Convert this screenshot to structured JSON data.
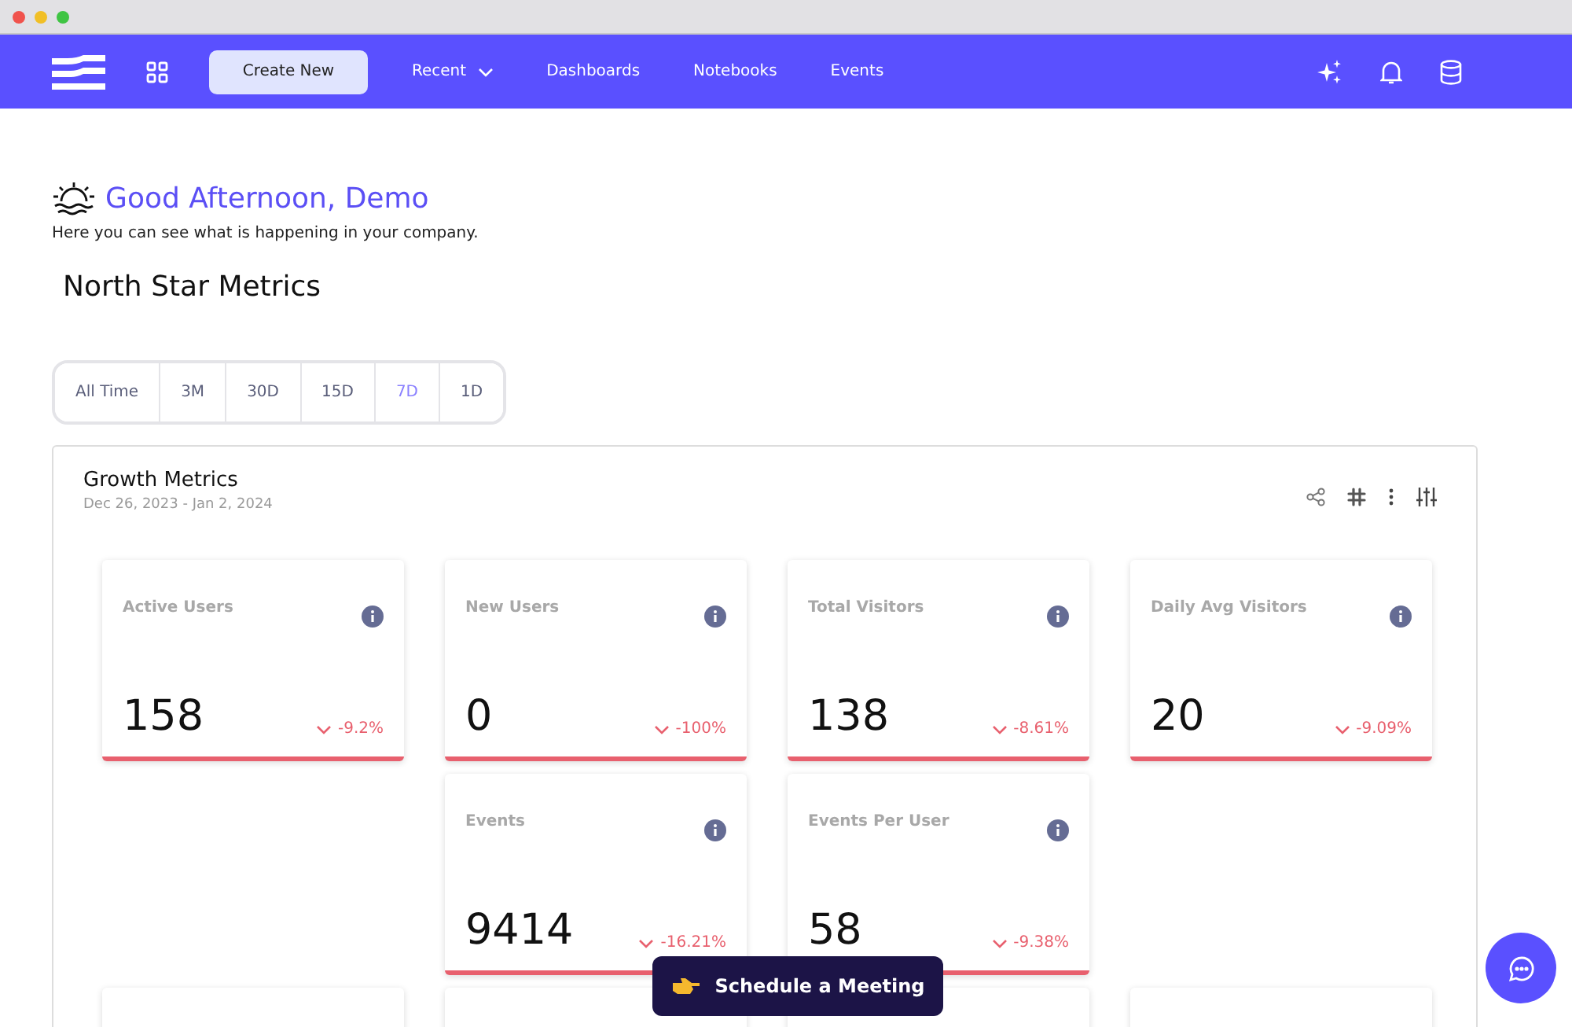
{
  "nav": {
    "create_button": "Create New",
    "items": [
      {
        "label": "Recent",
        "kind": "dropdown"
      },
      {
        "label": "Dashboards",
        "kind": "link"
      },
      {
        "label": "Notebooks",
        "kind": "link"
      },
      {
        "label": "Events",
        "kind": "link"
      }
    ]
  },
  "greeting": {
    "title": "Good Afternoon, Demo",
    "subtitle": "Here you can see what is happening in your company."
  },
  "section_title": "North Star Metrics",
  "ranges": [
    {
      "label": "All Time",
      "selected": false
    },
    {
      "label": "3M",
      "selected": false
    },
    {
      "label": "30D",
      "selected": false
    },
    {
      "label": "15D",
      "selected": false
    },
    {
      "label": "7D",
      "selected": true
    },
    {
      "label": "1D",
      "selected": false
    }
  ],
  "panel": {
    "title": "Growth Metrics",
    "date_range": "Dec 26, 2023 - Jan 2, 2024",
    "rows": [
      [
        {
          "kind": "metric",
          "label": "Active Users",
          "value": "158",
          "change": "-9.2%",
          "declining": true
        },
        {
          "kind": "metric",
          "label": "New Users",
          "value": "0",
          "change": "-100%",
          "declining": true
        },
        {
          "kind": "metric",
          "label": "Total Visitors",
          "value": "138",
          "change": "-8.61%",
          "declining": true
        },
        {
          "kind": "metric",
          "label": "Daily Avg Visitors",
          "value": "20",
          "change": "-9.09%",
          "declining": true
        }
      ],
      [
        {
          "kind": "empty"
        },
        {
          "kind": "metric",
          "label": "Events",
          "value": "9414",
          "change": "-16.21%",
          "declining": true
        },
        {
          "kind": "metric",
          "label": "Events Per User",
          "value": "58",
          "change": "-9.38%",
          "declining": true
        },
        {
          "kind": "empty"
        }
      ],
      [
        {
          "kind": "blank"
        },
        {
          "kind": "blank"
        },
        {
          "kind": "blank"
        },
        {
          "kind": "blank"
        }
      ]
    ]
  },
  "schedule_button": "Schedule a Meeting"
}
